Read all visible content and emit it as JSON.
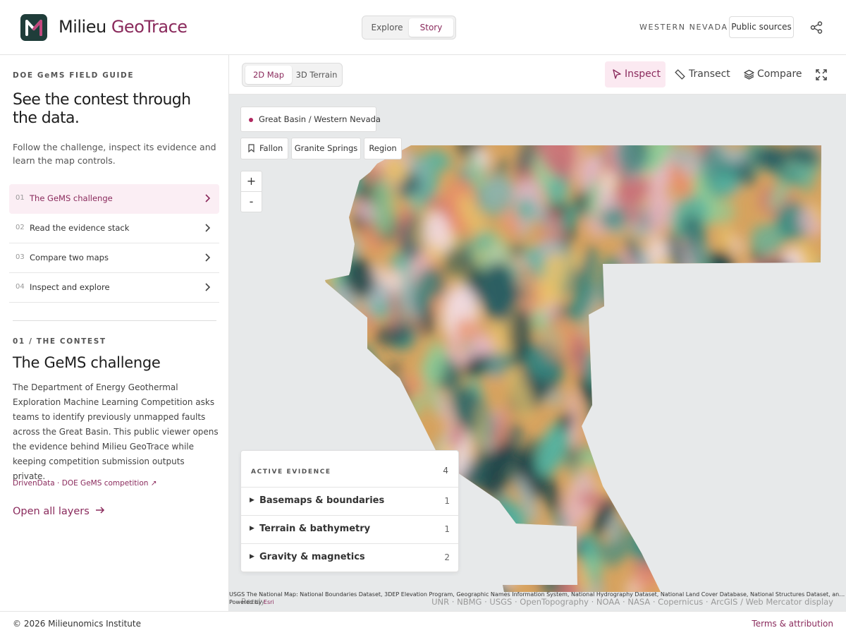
{
  "header": {
    "brand_part1": "Milieu",
    "brand_part2": "GeoTrace",
    "modes": [
      "Explore",
      "Story"
    ],
    "active_mode": "Story",
    "region": "WESTERN NEVADA",
    "public_sources_label": "Public sources",
    "share_icon": "share-icon"
  },
  "sidebar": {
    "eyebrow": "DOE GeMS FIELD GUIDE",
    "title": "See the contest through the data.",
    "intro": "Follow the challenge, inspect its evidence and learn the map controls.",
    "steps": [
      {
        "num": "01",
        "label": "The GeMS challenge",
        "active": true
      },
      {
        "num": "02",
        "label": "Read the evidence stack",
        "active": false
      },
      {
        "num": "03",
        "label": "Compare two maps",
        "active": false
      },
      {
        "num": "04",
        "label": "Inspect and explore",
        "active": false
      }
    ],
    "section_eyebrow": "01 / THE CONTEST",
    "section_title": "The GeMS challenge",
    "section_body": "The Department of Energy Geothermal Exploration Machine Learning Competition asks teams to identify previously unmapped faults across the Great Basin. This public viewer opens the evidence behind Milieu GeoTrace while keeping competition submission outputs private.",
    "section_link": "DrivenData · DOE GeMS competition ↗",
    "open_layers": "Open all layers"
  },
  "map_toolbar": {
    "views": [
      "2D Map",
      "3D Terrain"
    ],
    "active_view": "2D Map",
    "tools": [
      "Inspect",
      "Transect",
      "Compare"
    ],
    "active_tool": "Inspect",
    "colors": {
      "accent": "#8a2a5c",
      "accent_bg": "#fbe9f1"
    }
  },
  "map": {
    "location_chip": "Great Basin / Western Nevada",
    "bookmarks": [
      "Fallon",
      "Granite Springs",
      "Region"
    ],
    "zoom_in": "+",
    "zoom_out": "-",
    "evidence": {
      "title": "ACTIVE EVIDENCE",
      "count": "4",
      "groups": [
        {
          "label": "Basemaps & boundaries",
          "count": "1"
        },
        {
          "label": "Terrain & bathymetry",
          "count": "1"
        },
        {
          "label": "Gravity & magnetics",
          "count": "2"
        }
      ]
    },
    "attribution": "USGS The National Map: National Boundaries Dataset, 3DEP Elevation Program, Geographic Names Information System, National Hydrography Dataset, National Land Cover Database, National Structures Dataset, and National Transportation Dataset",
    "powered_by": "Powered by",
    "esri": "Esri",
    "status": "Ready",
    "sources": "UNR · NBMG · USGS · OpenTopography · NOAA · NASA · Copernicus · ArcGIS / Web Mercator display"
  },
  "footer": {
    "copyright": "© 2026 Milieunomics Institute",
    "terms": "Terms & attribution"
  }
}
